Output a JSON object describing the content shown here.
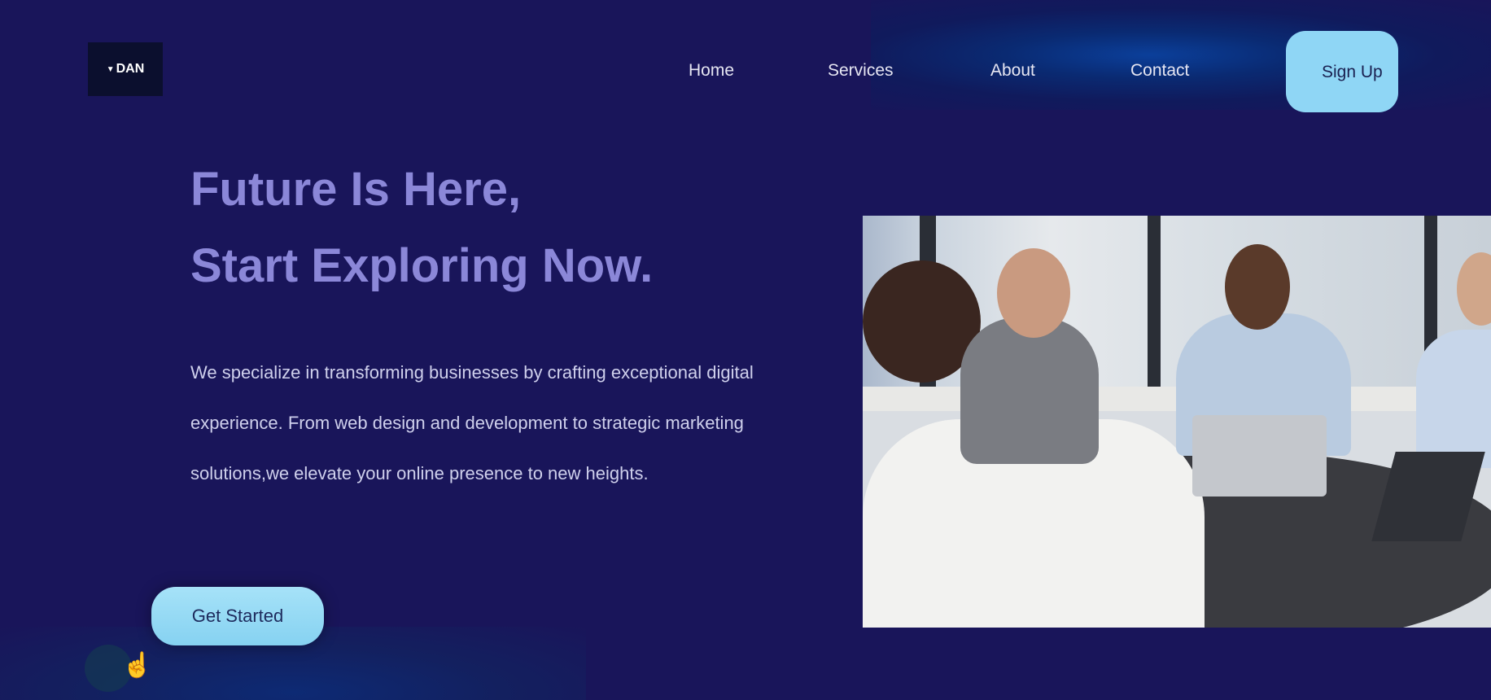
{
  "logo": {
    "text": "DAN"
  },
  "nav": {
    "items": [
      "Home",
      "Services",
      "About",
      "Contact"
    ],
    "signup": "Sign Up"
  },
  "hero": {
    "title_line1": "Future Is Here,",
    "title_line2": "Start Exploring Now.",
    "description": "We specialize in transforming businesses by crafting exceptional digital experience. From web design and development to strategic marketing solutions,we elevate your online presence to new heights.",
    "cta": "Get Started"
  },
  "colors": {
    "background": "#19155a",
    "accent": "#8fd6f5",
    "heading": "#8b87d8"
  }
}
